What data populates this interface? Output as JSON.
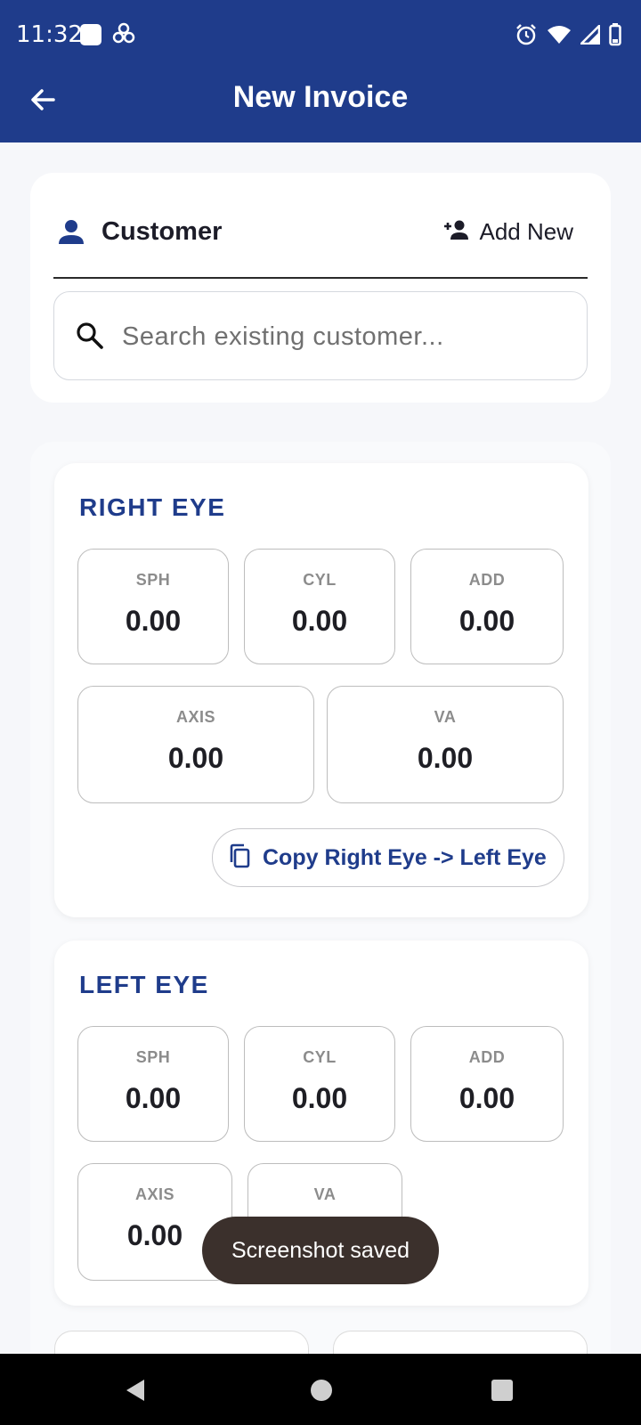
{
  "status_bar": {
    "time": "11:32"
  },
  "app_bar": {
    "title": "New Invoice"
  },
  "customer": {
    "title": "Customer",
    "add_new_label": "Add New",
    "search_placeholder": "Search existing customer..."
  },
  "right_eye": {
    "title": "RIGHT EYE",
    "fields": [
      {
        "label": "SPH",
        "value": "0.00"
      },
      {
        "label": "CYL",
        "value": "0.00"
      },
      {
        "label": "ADD",
        "value": "0.00"
      },
      {
        "label": "AXIS",
        "value": "0.00"
      },
      {
        "label": "VA",
        "value": "0.00"
      }
    ],
    "copy_label": "Copy Right Eye -> Left Eye"
  },
  "left_eye": {
    "title": "LEFT EYE",
    "fields": [
      {
        "label": "SPH",
        "value": "0.00"
      },
      {
        "label": "CYL",
        "value": "0.00"
      },
      {
        "label": "ADD",
        "value": "0.00"
      },
      {
        "label": "AXIS",
        "value": "0.00"
      },
      {
        "label": "VA",
        "value": ""
      }
    ]
  },
  "toast": {
    "message": "Screenshot saved"
  },
  "colors": {
    "primary": "#1f3c8b",
    "toast_bg": "#3b302c"
  }
}
